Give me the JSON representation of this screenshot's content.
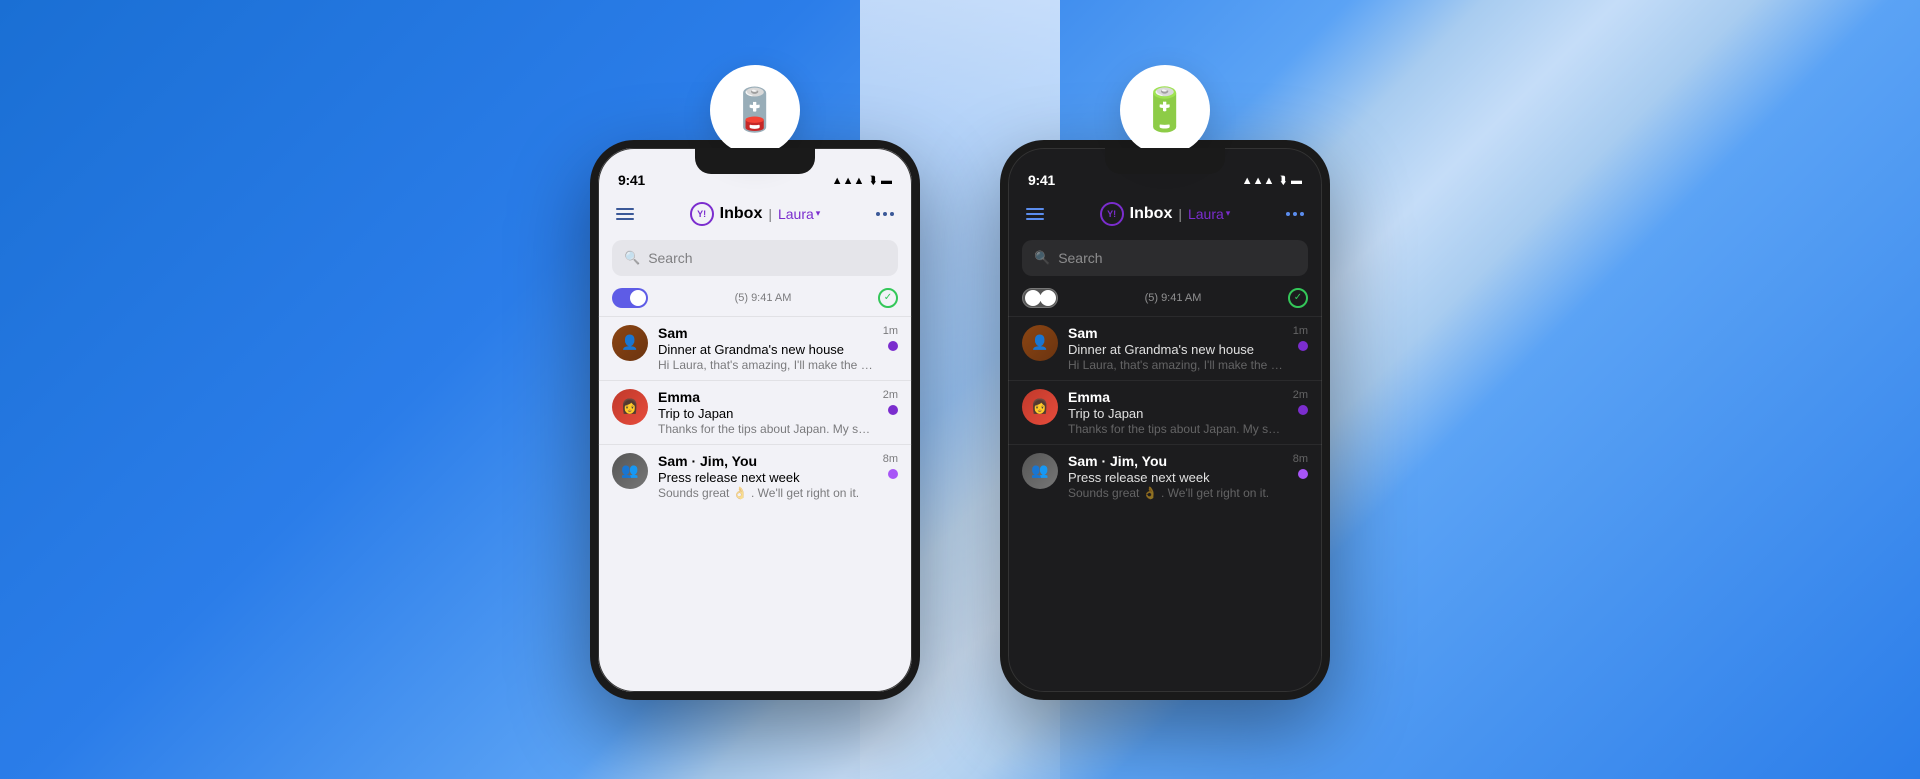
{
  "background": {
    "left_color": "#1a6fd4",
    "right_color": "#4a90d9",
    "beam_color": "rgba(255,255,255,0.6)"
  },
  "phone_left": {
    "theme": "light",
    "battery_icon": "🪫",
    "battery_color": "#f5c518",
    "status": {
      "time": "9:41",
      "signal": "▲▲▲",
      "wifi": "wifi",
      "battery": "🔋"
    },
    "header": {
      "menu_label": "menu",
      "yahoo_logo": "y!",
      "inbox_label": "Inbox",
      "pipe": "|",
      "user": "Laura",
      "more_label": "..."
    },
    "search": {
      "placeholder": "Search"
    },
    "toggle_info": "(5) 9:41 AM",
    "emails": [
      {
        "sender": "Sam",
        "subject": "Dinner at Grandma's new house",
        "preview": "Hi Laura, that's amazing, I'll make the mashed pot...",
        "time": "1m",
        "unread": true,
        "avatar_type": "sam"
      },
      {
        "sender": "Emma",
        "subject": "Trip to Japan",
        "preview": "Thanks for the tips about Japan. My sister loved it.",
        "time": "2m",
        "unread": true,
        "avatar_type": "emma"
      },
      {
        "sender": "Sam · Jim, You",
        "subject": "Press release next week",
        "preview": "Sounds great 👌 . We'll get right on it.",
        "time": "8m",
        "unread": true,
        "avatar_type": "group"
      }
    ]
  },
  "phone_right": {
    "theme": "dark",
    "battery_icon": "🔋",
    "battery_color": "#4cd964",
    "status": {
      "time": "9:41",
      "signal": "▲▲▲",
      "wifi": "wifi",
      "battery": "🔋"
    },
    "header": {
      "menu_label": "menu",
      "yahoo_logo": "y!",
      "inbox_label": "Inbox",
      "pipe": "|",
      "user": "Laura",
      "more_label": "..."
    },
    "search": {
      "placeholder": "Search"
    },
    "toggle_info": "(5) 9:41 AM",
    "emails": [
      {
        "sender": "Sam",
        "subject": "Dinner at Grandma's new house",
        "preview": "Hi Laura, that's amazing, I'll make the mashed pot...",
        "time": "1m",
        "unread": true,
        "avatar_type": "sam"
      },
      {
        "sender": "Emma",
        "subject": "Trip to Japan",
        "preview": "Thanks for the tips about Japan. My sister loved it.",
        "time": "2m",
        "unread": true,
        "avatar_type": "emma"
      },
      {
        "sender": "Sam · Jim, You",
        "subject": "Press release next week",
        "preview": "Sounds great 👌 . We'll get right on it.",
        "time": "8m",
        "unread": true,
        "avatar_type": "group"
      }
    ]
  }
}
